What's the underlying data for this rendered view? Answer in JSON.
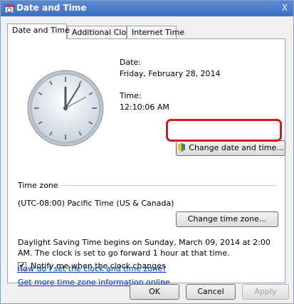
{
  "window": {
    "title": "Date and Time",
    "close_label": "X"
  },
  "tabs": [
    {
      "label": "Date and Time"
    },
    {
      "label": "Additional Clocks"
    },
    {
      "label": "Internet Time"
    }
  ],
  "datetime": {
    "date_label": "Date:",
    "date_value": "Friday, February 28, 2014",
    "time_label": "Time:",
    "time_value": "12:10:06 AM",
    "change_button": "Change date and time..."
  },
  "timezone": {
    "section_label": "Time zone",
    "value": "(UTC-08:00) Pacific Time (US & Canada)",
    "change_button": "Change time zone...",
    "dst_note": "Daylight Saving Time begins on Sunday, March 09, 2014 at 2:00 AM. The clock is set to go forward 1 hour at that time.",
    "notify_label": "Notify me when the clock changes",
    "notify_checked": true
  },
  "links": {
    "more_info": "Get more time zone information online",
    "how_to": "How do I set the clock and time zone?"
  },
  "footer": {
    "ok": "OK",
    "cancel": "Cancel",
    "apply": "Apply"
  },
  "colors": {
    "highlight": "#e0141e",
    "link": "#0033cc"
  },
  "icons": {
    "title": "clock-calendar-icon",
    "change_button": "uac-shield-icon"
  }
}
